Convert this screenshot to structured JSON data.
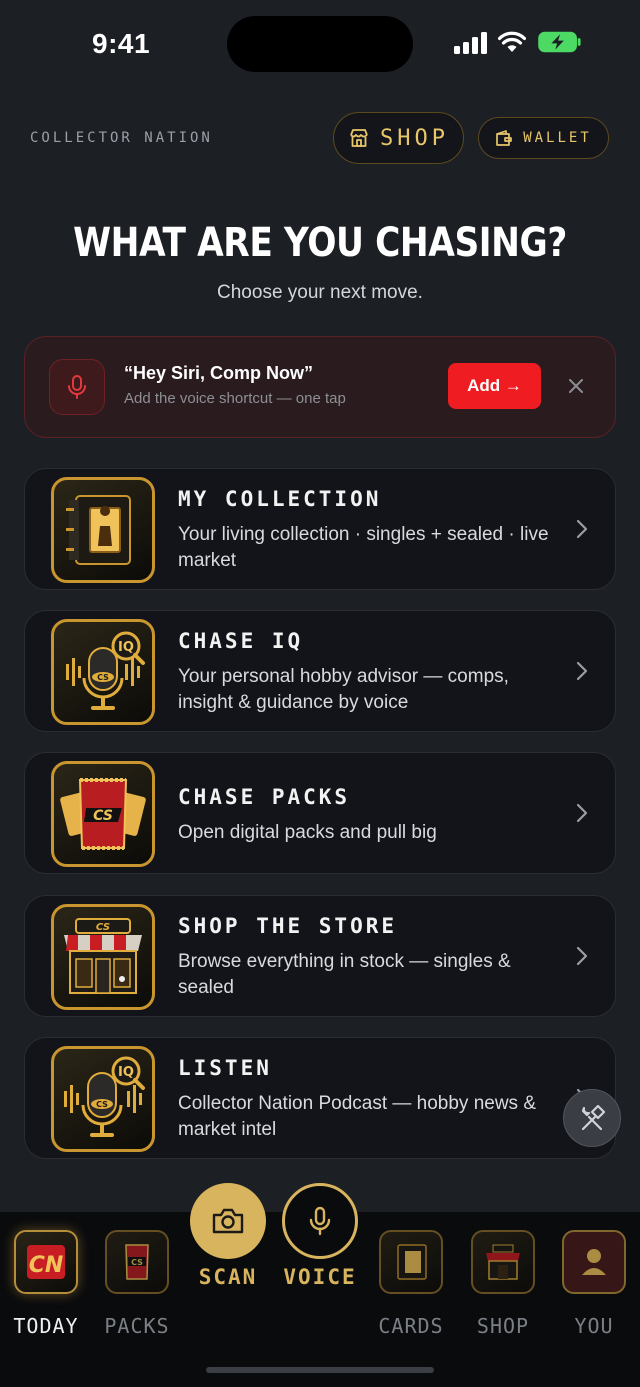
{
  "status": {
    "time": "9:41"
  },
  "header": {
    "brand": "COLLECTOR NATION",
    "shop_label": "SHOP",
    "wallet_label": "WALLET"
  },
  "hero": {
    "title": "WHAT ARE YOU CHASING?",
    "subtitle": "Choose your next move."
  },
  "siri_banner": {
    "title": "“Hey Siri, Comp Now”",
    "subtitle": "Add the voice shortcut — one tap",
    "add_label": "Add →"
  },
  "cards": [
    {
      "title": "MY COLLECTION",
      "desc": "Your living collection · singles + sealed · live market",
      "icon": "card-binder-icon"
    },
    {
      "title": "CHASE IQ",
      "desc": "Your personal hobby advisor — comps, insight & guidance by voice",
      "icon": "microphone-iq-icon"
    },
    {
      "title": "CHASE PACKS",
      "desc": "Open digital packs and pull big",
      "icon": "card-pack-icon"
    },
    {
      "title": "SHOP THE STORE",
      "desc": "Browse everything in stock — singles & sealed",
      "icon": "storefront-icon"
    },
    {
      "title": "LISTEN",
      "desc": "Collector Nation Podcast — hobby news & market intel",
      "icon": "podcast-mic-icon"
    }
  ],
  "tabbar": {
    "today": "TODAY",
    "packs": "PACKS",
    "scan": "SCAN",
    "voice": "VOICE",
    "cards": "CARDS",
    "shop": "SHOP",
    "you": "YOU"
  },
  "colors": {
    "accent_gold": "#d9b45e",
    "alert_red": "#ef1d22",
    "background": "#1c1f24"
  }
}
